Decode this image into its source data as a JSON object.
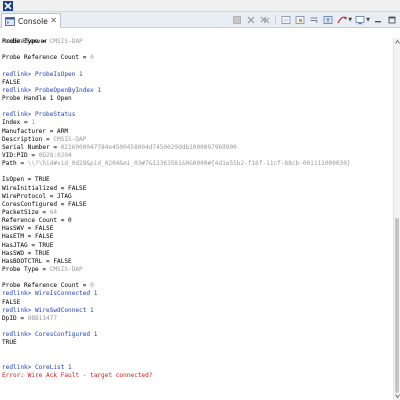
{
  "window": {
    "app_icon": "redlink-x-icon"
  },
  "tab": {
    "label": "Console",
    "icon": "console-icon",
    "close": "✕"
  },
  "toolbar": {
    "buttons": [
      "terminate-icon",
      "remove-launch-icon",
      "remove-all-icon",
      "clear-console-icon",
      "scroll-lock-icon",
      "word-wrap-icon",
      "pin-console-icon",
      "open-console-icon",
      "display-console-icon",
      "minimize-icon",
      "maximize-icon"
    ]
  },
  "session": {
    "label": "RedlinkServer"
  },
  "console": {
    "lines": [
      {
        "type": "out",
        "key": "Probe Type = ",
        "val": "CMSIS-DAP"
      },
      {
        "type": "blank",
        "text": ""
      },
      {
        "type": "out",
        "key": "Probe Reference Count = ",
        "val": "0"
      },
      {
        "type": "blank",
        "text": ""
      },
      {
        "type": "cmd",
        "text": "redlink> ProbeIsOpen 1"
      },
      {
        "type": "plain",
        "text": "FALSE"
      },
      {
        "type": "cmd",
        "text": "redlink> ProbeOpenByIndex 1"
      },
      {
        "type": "plain",
        "text": "Probe Handle 1 Open"
      },
      {
        "type": "blank",
        "text": ""
      },
      {
        "type": "cmd",
        "text": "redlink> ProbeStatus"
      },
      {
        "type": "out",
        "key": "Index = ",
        "val": "1"
      },
      {
        "type": "plain",
        "text": "Manufacturer = ARM"
      },
      {
        "type": "out",
        "key": "Description = ",
        "val": "CMSIS-DAP"
      },
      {
        "type": "out",
        "key": "Serial Number = ",
        "val": "0226000047784e4500458004d7450029ddb1000097969900"
      },
      {
        "type": "out",
        "key": "VID:PID = ",
        "val": "0D28:0204"
      },
      {
        "type": "out",
        "key": "Path = ",
        "val": "\\\\?\\hid#vid_0d28&pid_0204&mi_03#7&12363581&0&0000#{4d1e55b2-f16f-11cf-88cb-001111000030}"
      },
      {
        "type": "blank",
        "text": ""
      },
      {
        "type": "plain",
        "text": "IsOpen = TRUE"
      },
      {
        "type": "plain",
        "text": "WireInitialized = FALSE"
      },
      {
        "type": "plain",
        "text": "WireProtocol = JTAG"
      },
      {
        "type": "plain",
        "text": "CoresConfigured = FALSE"
      },
      {
        "type": "out",
        "key": "PacketSize = ",
        "val": "64"
      },
      {
        "type": "plain",
        "text": "Reference Count = 0"
      },
      {
        "type": "plain",
        "text": "HasSWV = FALSE"
      },
      {
        "type": "plain",
        "text": "HasETM = FALSE"
      },
      {
        "type": "plain",
        "text": "HasJTAG = TRUE"
      },
      {
        "type": "plain",
        "text": "HasSWD = TRUE"
      },
      {
        "type": "plain",
        "text": "HasBOOTCTRL = FALSE"
      },
      {
        "type": "out",
        "key": "Probe Type = ",
        "val": "CMSIS-DAP"
      },
      {
        "type": "blank",
        "text": ""
      },
      {
        "type": "out",
        "key": "Probe Reference Count = ",
        "val": "0"
      },
      {
        "type": "cmd",
        "text": "redlink> WireIsConnected 1"
      },
      {
        "type": "plain",
        "text": "FALSE"
      },
      {
        "type": "cmd",
        "text": "redlink> WireSwdConnect 1"
      },
      {
        "type": "out",
        "key": "DpID = ",
        "val": "0BB11477"
      },
      {
        "type": "blank",
        "text": ""
      },
      {
        "type": "cmd",
        "text": "redlink> CoresConfigured 1"
      },
      {
        "type": "plain",
        "text": "TRUE"
      },
      {
        "type": "blank",
        "text": ""
      },
      {
        "type": "blank",
        "text": ""
      },
      {
        "type": "cmd",
        "text": "redlink> CoreList 1"
      },
      {
        "type": "err",
        "text": "Error: Wire Ack Fault - target connected?"
      }
    ]
  },
  "colors": {
    "command": "#1f3fbf",
    "error": "#d11a1a",
    "value": "#9a9a9a",
    "text": "#000000"
  }
}
